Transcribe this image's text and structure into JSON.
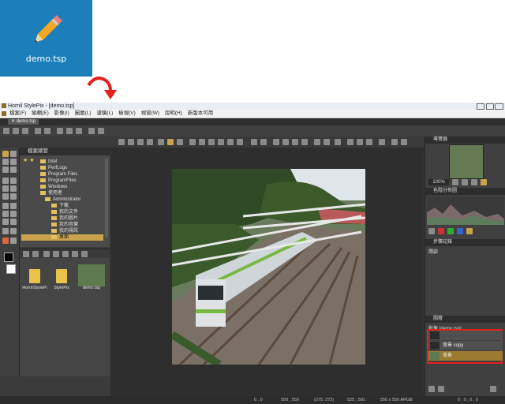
{
  "desktop_icon": {
    "label": "demo.tsp"
  },
  "window": {
    "title": "Hornil StylePix - [demo.tsp]",
    "menu": [
      "檔案(F)",
      "編輯(E)",
      "影像(I)",
      "圖層(L)",
      "濾鏡(L)",
      "檢視(V)",
      "視窗(W)",
      "說明(H)",
      "新版本可用"
    ],
    "tab": "demo.tsp"
  },
  "folder_panel": {
    "header": "檔案總管",
    "items": [
      "Intel",
      "PerfLogs",
      "Program Files",
      "ProgramFiles",
      "Windows",
      "使用者",
      "Administrator",
      "下載",
      "我的文件",
      "我的圖片",
      "我的音樂",
      "我的視訊",
      "桌面"
    ]
  },
  "files": [
    {
      "label": "HornilStylePi"
    },
    {
      "label": "StylePix"
    },
    {
      "label": "demo.tsp"
    }
  ],
  "right_panel": {
    "navigator": "導覽器",
    "zoom": "100%",
    "histogram": "色階分佈圖",
    "history": "步驟記錄",
    "history_item": "開啟",
    "layers": "圖層",
    "layers_file": "影像 [demo.tsp]",
    "layer_items": [
      "背景 copy",
      "背景"
    ]
  },
  "status": {
    "pos": "0 , 0",
    "size1": "550 , 550",
    "coord": "(275, 273)",
    "pos2": "525 , 581",
    "doc": "550 x 550 ARGB",
    "zeros": "0 , 0 , 0 , 0"
  },
  "colors": {
    "desktop_icon_bg": "#1c7fb9",
    "arrow": "#e3201b",
    "layer_highlight": "#e3201b",
    "selected_layer": "#9a7b30"
  }
}
